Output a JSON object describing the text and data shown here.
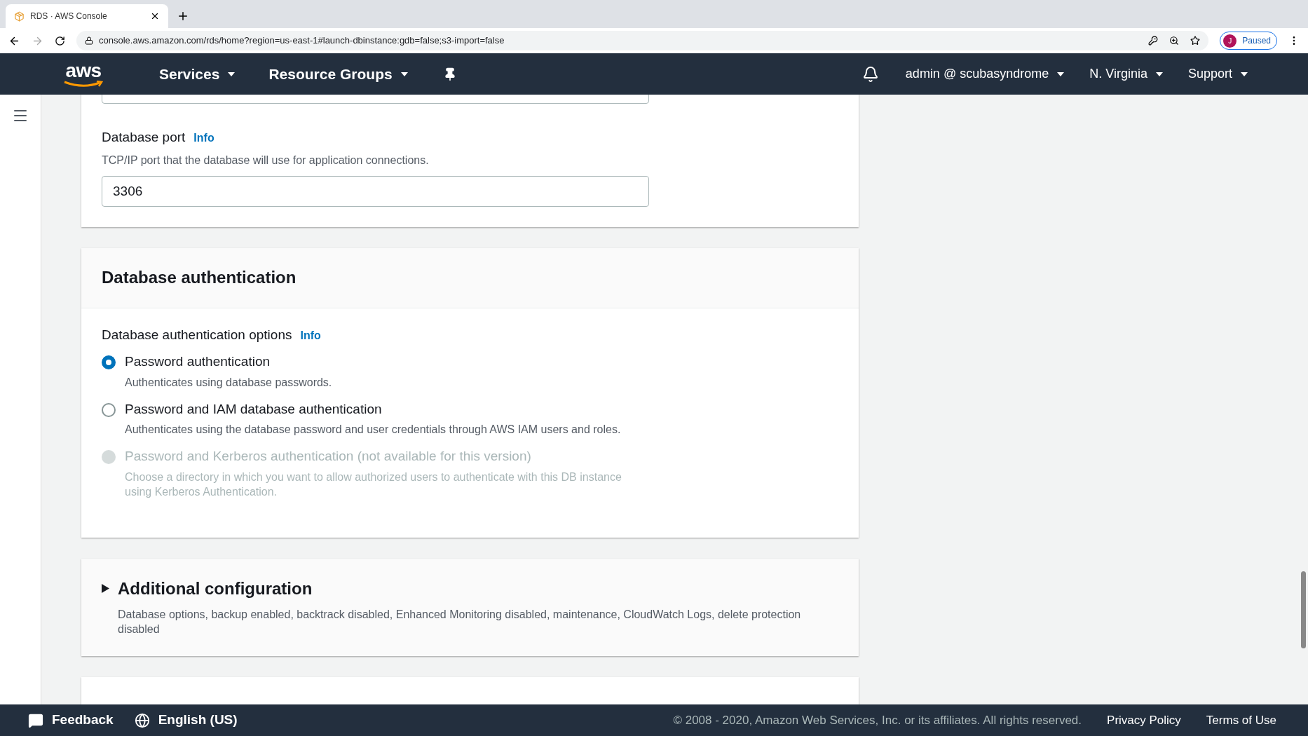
{
  "browser": {
    "tab": {
      "title": "RDS · AWS Console"
    },
    "url": "console.aws.amazon.com/rds/home?region=us-east-1#launch-dbinstance:gdb=false;s3-import=false",
    "profile": {
      "initial": "J",
      "status": "Paused"
    }
  },
  "nav": {
    "logo": "aws",
    "menus": [
      "Services",
      "Resource Groups"
    ],
    "right_menus": [
      "admin @ scubasyndrome",
      "N. Virginia",
      "Support"
    ]
  },
  "port": {
    "label": "Database port",
    "info": "Info",
    "description": "TCP/IP port that the database will use for application connections.",
    "value": "3306"
  },
  "auth": {
    "title": "Database authentication",
    "label": "Database authentication options",
    "info": "Info",
    "options": [
      {
        "label": "Password authentication",
        "description": "Authenticates using database passwords.",
        "selected": true,
        "disabled": false
      },
      {
        "label": "Password and IAM database authentication",
        "description": "Authenticates using the database password and user credentials through AWS IAM users and roles.",
        "selected": false,
        "disabled": false
      },
      {
        "label": "Password and Kerberos authentication (not available for this version)",
        "description": "Choose a directory in which you want to allow authorized users to authenticate with this DB instance using Kerberos Authentication.",
        "selected": false,
        "disabled": true
      }
    ]
  },
  "additional": {
    "title": "Additional configuration",
    "expanded": false,
    "description": "Database options, backup enabled, backtrack disabled, Enhanced Monitoring disabled, maintenance, CloudWatch Logs, delete protection disabled"
  },
  "footer": {
    "feedback": "Feedback",
    "language": "English (US)",
    "copyright": "© 2008 - 2020, Amazon Web Services, Inc. or its affiliates. All rights reserved.",
    "links": [
      "Privacy Policy",
      "Terms of Use"
    ]
  }
}
